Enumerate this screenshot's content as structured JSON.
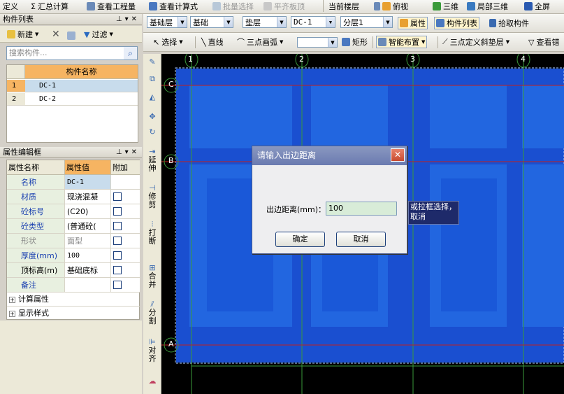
{
  "toolbar1": {
    "items": [
      "定义",
      "汇总计算",
      "查看工程量",
      "查看计算式",
      "批量选择",
      "平齐板顶",
      "当前楼层",
      "俯视",
      "三维",
      "局部三维",
      "全屏"
    ]
  },
  "toolbar2": {
    "dropdowns": [
      "基础层",
      "基础",
      "垫层",
      "DC-1",
      "分层1"
    ],
    "buttons": [
      "属性",
      "构件列表",
      "拾取构件"
    ]
  },
  "toolbar3": {
    "buttons": [
      "选择",
      "直线",
      "三点画弧",
      "矩形",
      "智能布置",
      "三点定义斜垫层",
      "查看错"
    ]
  },
  "component_list": {
    "title": "构件列表",
    "new_label": "新建",
    "filter_label": "过滤",
    "search_placeholder": "搜索构件...",
    "header": "构件名称",
    "rows": [
      {
        "num": "1",
        "name": "DC-1"
      },
      {
        "num": "2",
        "name": "DC-2"
      }
    ]
  },
  "property_panel": {
    "title": "属性编辑框",
    "headers": [
      "属性名称",
      "属性值",
      "附加"
    ],
    "rows": [
      {
        "name": "名称",
        "value": "DC-1"
      },
      {
        "name": "材质",
        "value": "现浇混凝"
      },
      {
        "name": "砼标号",
        "value": "(C20)"
      },
      {
        "name": "砼类型",
        "value": "(普通砼("
      },
      {
        "name": "形状",
        "value": "面型"
      },
      {
        "name": "厚度(mm)",
        "value": "100"
      },
      {
        "name": "顶标高(m)",
        "value": "基础底标"
      },
      {
        "name": "备注",
        "value": ""
      }
    ],
    "groups": [
      "计算属性",
      "显示样式"
    ]
  },
  "vertical_toolbar": [
    "延伸",
    "修剪",
    "打断",
    "合并",
    "分割",
    "对齐"
  ],
  "axes": {
    "columns": [
      "1",
      "2",
      "3",
      "4"
    ],
    "rows": [
      "C",
      "B",
      "A"
    ]
  },
  "tooltip": {
    "line1": "或拉框选择，",
    "line2": "取消"
  },
  "dialog": {
    "title": "请输入出边距离",
    "label": "出边距离(mm)：",
    "value": "100",
    "ok": "确定",
    "cancel": "取消"
  }
}
